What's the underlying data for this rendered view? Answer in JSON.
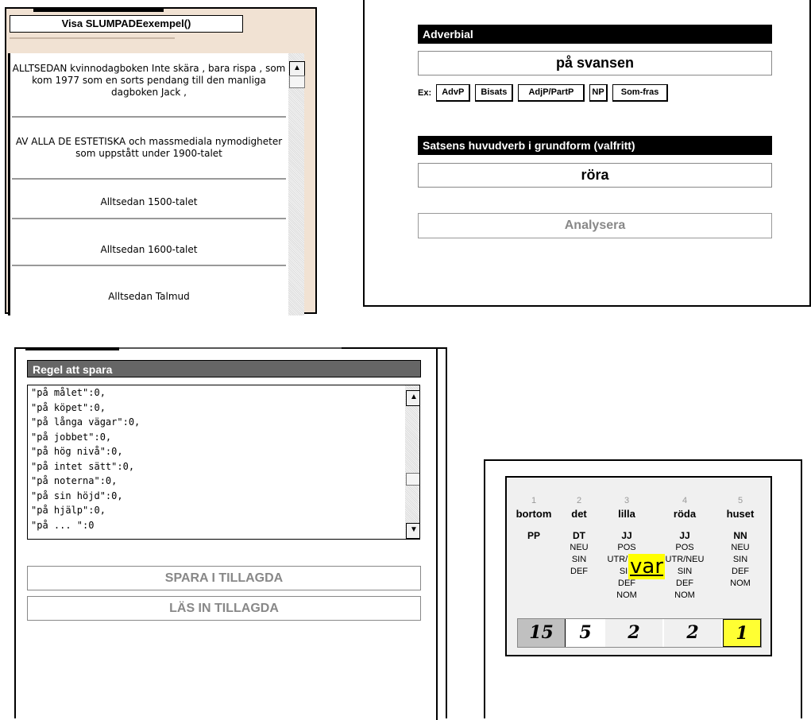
{
  "panel_examples": {
    "button_label": "Visa SLUMPADEexempel()",
    "items": [
      "ALLTSEDAN kvinnodagboken Inte skära , bara rispa , som kom 1977 som en sorts pendang till den manliga dagboken Jack ,",
      "AV ALLA DE ESTETISKA och massmediala nymodigheter som uppstått under 1900-talet",
      "Alltsedan 1500-talet",
      "Alltsedan 1600-talet",
      "Alltsedan Talmud"
    ]
  },
  "panel_adverbial": {
    "adverbial_header": "Adverbial",
    "adverbial_value": "på svansen",
    "ex_label": "Ex:",
    "examples": [
      "AdvP",
      "Bisats",
      "AdjP/PartP",
      "NP",
      "Som-fras"
    ],
    "verb_header": "Satsens huvudverb i grundform (valfritt)",
    "verb_value": "röra",
    "analyze_label": "Analysera"
  },
  "panel_rule": {
    "header": "Regel att spara",
    "code_lines": [
      "\"på målet\":0,",
      "\"på köpet\":0,",
      "\"på långa vägar\":0,",
      "\"på jobbet\":0,",
      "\"på hög nivå\":0,",
      "\"på intet sätt\":0,",
      "\"på noterna\":0,",
      "\"på sin höjd\":0,",
      "\"på hjälp\":0,",
      "\"på ... \":0"
    ],
    "save_label": "SPARA I TILLAGDA",
    "load_label": "LÄS IN TILLAGDA"
  },
  "panel_tokens": {
    "tokens": [
      {
        "num": "1",
        "word": "bortom",
        "pos": "PP",
        "feats": ""
      },
      {
        "num": "2",
        "word": "det",
        "pos": "DT",
        "feats": "NEU\nSIN\nDEF"
      },
      {
        "num": "3",
        "word": "lilla",
        "pos": "JJ",
        "feats": "POS\nUTR/NEU\nSIN\nDEF\nNOM"
      },
      {
        "num": "4",
        "word": "röda",
        "pos": "JJ",
        "feats": "POS\nUTR/NEU\nSIN\nDEF\nNOM"
      },
      {
        "num": "5",
        "word": "huset",
        "pos": "NN",
        "feats": "NEU\nSIN\nDEF\nNOM"
      }
    ],
    "counts": [
      "15",
      "5",
      "2",
      "2",
      "1"
    ],
    "count_colors": [
      "#c0c0c0",
      "#ffffff",
      "#f0f0f0",
      "#f0f0f0",
      "#ffff33"
    ],
    "highlight_word": "var",
    "highlight_color": "#ffff00"
  }
}
